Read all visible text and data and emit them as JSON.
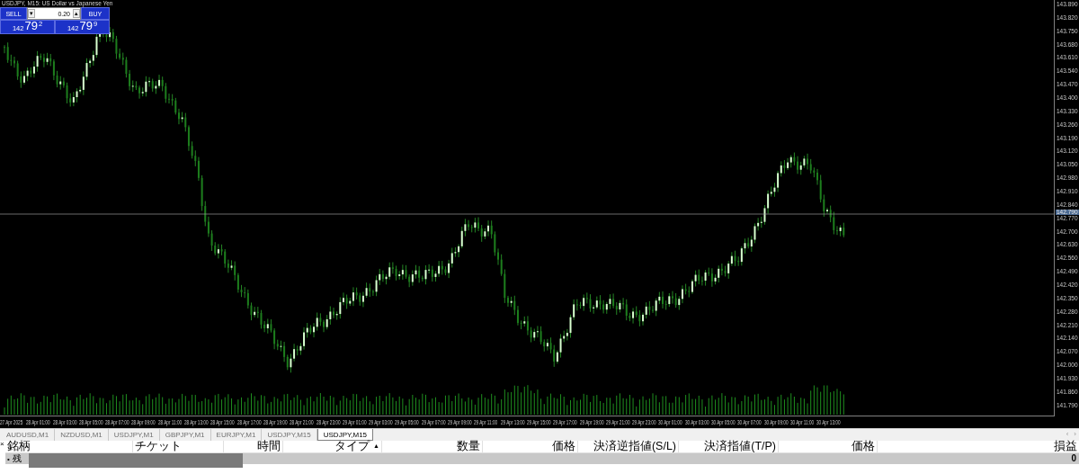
{
  "panel": {
    "title": "USDJPY, M15:  US Dollar vs Japanese Yen",
    "sell": "SELL",
    "buy": "BUY",
    "lot": "0.20",
    "down": "▾",
    "up": "▴",
    "quotes": [
      {
        "big": "142",
        "main": "79",
        "small": "2"
      },
      {
        "big": "142",
        "main": "79",
        "small": "9"
      }
    ]
  },
  "price_axis": {
    "labels": [
      "143.890",
      "143.820",
      "143.750",
      "143.680",
      "143.610",
      "143.540",
      "143.470",
      "143.400",
      "143.330",
      "143.260",
      "143.190",
      "143.120",
      "143.050",
      "142.980",
      "142.910",
      "142.840",
      "142.770",
      "142.700",
      "142.630",
      "142.560",
      "142.490",
      "142.420",
      "142.350",
      "142.280",
      "142.210",
      "142.140",
      "142.070",
      "142.000",
      "141.930",
      "141.860",
      "141.790"
    ],
    "current": "142.790"
  },
  "time_axis": {
    "labels": [
      "27 Apr 2025",
      "28 Apr 01:00",
      "28 Apr 03:00",
      "28 Apr 05:00",
      "28 Apr 07:00",
      "28 Apr 09:00",
      "28 Apr 11:00",
      "28 Apr 13:00",
      "28 Apr 15:00",
      "28 Apr 17:00",
      "28 Apr 19:00",
      "28 Apr 21:00",
      "28 Apr 23:00",
      "29 Apr 01:00",
      "29 Apr 03:00",
      "29 Apr 05:00",
      "29 Apr 07:00",
      "29 Apr 09:00",
      "29 Apr 11:00",
      "29 Apr 13:00",
      "29 Apr 15:00",
      "29 Apr 17:00",
      "29 Apr 19:00",
      "29 Apr 21:00",
      "29 Apr 23:00",
      "30 Apr 01:00",
      "30 Apr 03:00",
      "30 Apr 05:00",
      "30 Apr 07:00",
      "30 Apr 09:00",
      "30 Apr 11:00",
      "30 Apr 13:00"
    ]
  },
  "tabs": [
    {
      "label": "AUDUSD,M1",
      "selected": false
    },
    {
      "label": "NZDUSD,M1",
      "selected": false
    },
    {
      "label": "USDJPY,M1",
      "selected": false
    },
    {
      "label": "GBPJPY,M1",
      "selected": false
    },
    {
      "label": "EURJPY,M1",
      "selected": false
    },
    {
      "label": "USDJPY,M15",
      "selected": false
    },
    {
      "label": "USDJPY,M15",
      "selected": true
    }
  ],
  "tab_scroll": [
    "‹",
    "›"
  ],
  "terminal": {
    "close": "×",
    "columns": [
      {
        "label": "銘柄"
      },
      {
        "label": "チケット"
      },
      {
        "label": "時間"
      },
      {
        "label": "タイプ",
        "sort_mark": "▲"
      },
      {
        "label": "数量"
      },
      {
        "label": "価格"
      },
      {
        "label": "決済逆指値(S/L)"
      },
      {
        "label": "決済指値(T/P)"
      },
      {
        "label": "価格"
      },
      {
        "label": "損益"
      }
    ],
    "balance_row": {
      "marker": "•",
      "label": "残",
      "profit": "0"
    }
  }
}
